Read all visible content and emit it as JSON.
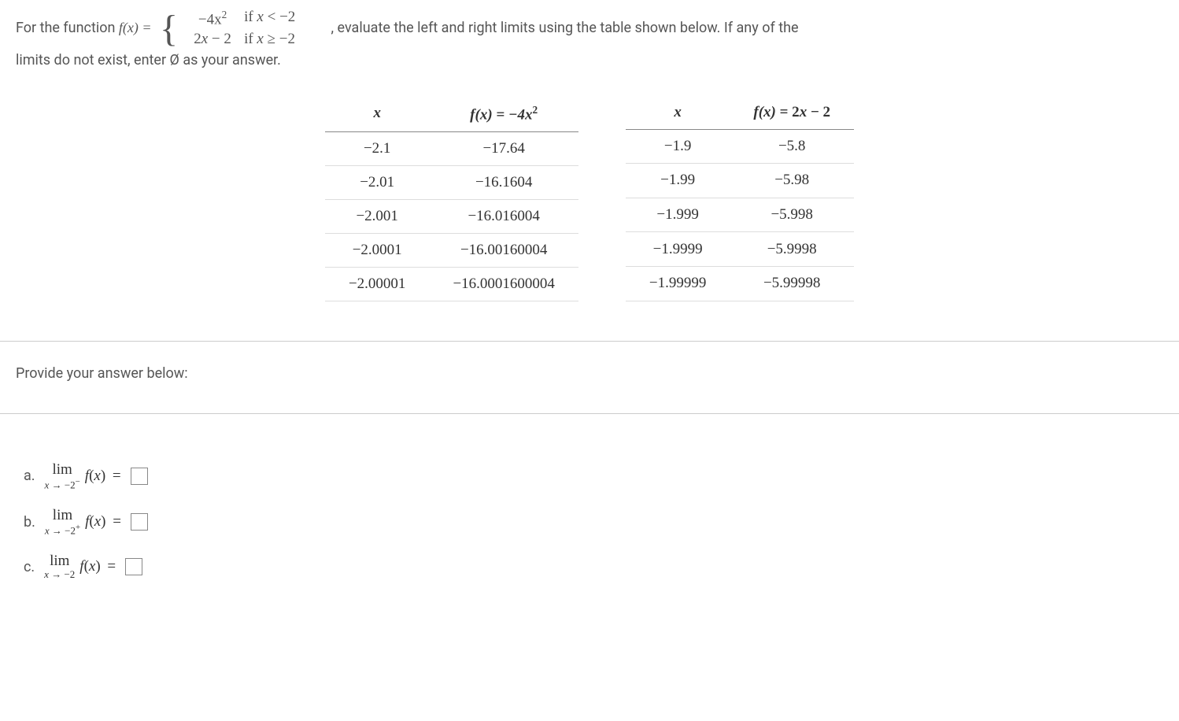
{
  "question": {
    "prefix": "For the function ",
    "func_name": "f(x) = ",
    "piecewise": {
      "row1_expr": "−4x",
      "row1_exp": "2",
      "row1_cond": "if x < −2",
      "row2_expr": "2x − 2",
      "row2_cond": "if x ≥ −2"
    },
    "middle": ", evaluate the left and right limits using the table shown below. If any of the",
    "line2": "limits do not exist, enter Ø as your answer."
  },
  "table_left": {
    "header1": "x",
    "header2_pre": "f(x) = −4x",
    "header2_exp": "2",
    "rows": [
      {
        "x": "−2.1",
        "fx": "−17.64"
      },
      {
        "x": "−2.01",
        "fx": "−16.1604"
      },
      {
        "x": "−2.001",
        "fx": "−16.016004"
      },
      {
        "x": "−2.0001",
        "fx": "−16.00160004"
      },
      {
        "x": "−2.00001",
        "fx": "−16.0001600004"
      }
    ]
  },
  "table_right": {
    "header1": "x",
    "header2": "f(x) = 2x − 2",
    "rows": [
      {
        "x": "−1.9",
        "fx": "−5.8"
      },
      {
        "x": "−1.99",
        "fx": "−5.98"
      },
      {
        "x": "−1.999",
        "fx": "−5.998"
      },
      {
        "x": "−1.9999",
        "fx": "−5.9998"
      },
      {
        "x": "−1.99999",
        "fx": "−5.99998"
      }
    ]
  },
  "answer": {
    "prompt": "Provide your answer below:",
    "items": [
      {
        "label": "a.",
        "lim": "lim",
        "sub": "x → −2",
        "sup": "−",
        "fx": "f(x) ="
      },
      {
        "label": "b.",
        "lim": "lim",
        "sub": "x → −2",
        "sup": "+",
        "fx": "f(x) ="
      },
      {
        "label": "c.",
        "lim": "lim",
        "sub": "x → −2",
        "sup": "",
        "fx": "f(x) ="
      }
    ]
  }
}
